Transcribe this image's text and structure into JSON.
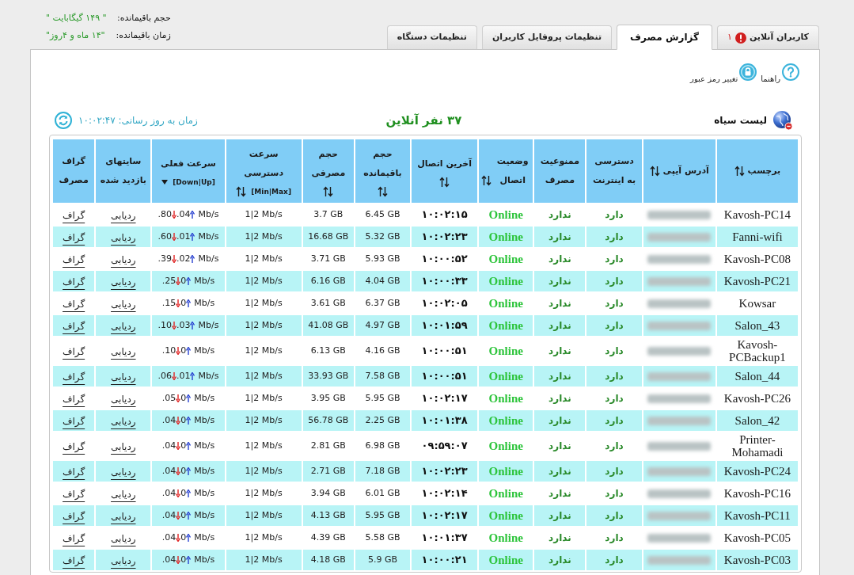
{
  "account": [
    {
      "label": "حجم باقیمانده:",
      "value": "\" ۱۴۹ گیگابایت \""
    },
    {
      "label": "زمان باقیمانده:",
      "value": "\"۱۴ ماه و ۴روز\""
    }
  ],
  "tabs": [
    {
      "label": "کاربران آنلاین",
      "selected": false,
      "alert": true,
      "count": "۱"
    },
    {
      "label": "گزارش مصرف",
      "selected": true,
      "alert": false
    },
    {
      "label": "تنظیمات پروفایل کاربران",
      "selected": false,
      "alert": false
    },
    {
      "label": "تنظیمات دستگاه",
      "selected": false,
      "alert": false
    }
  ],
  "toolbar": [
    {
      "kind": "help",
      "label": "راهنما"
    },
    {
      "kind": "password",
      "label": "تغییر رمز عبور"
    }
  ],
  "blacklist": {
    "label": "لیست سیاه"
  },
  "online_count": "۳۷ نفر آنلاین",
  "update_time": "زمان به روز رسانی: ۱۰:۰۲:۴۷",
  "table": {
    "columns": [
      {
        "label": "برچسب",
        "sortable": true,
        "sorted": false
      },
      {
        "label": "آدرس آیپی",
        "sortable": true,
        "sorted": false
      },
      {
        "label": "دسترسی به اینترنت",
        "sortable": false,
        "sorted": false
      },
      {
        "label": "ممنوعیت مصرف",
        "sortable": false,
        "sorted": false
      },
      {
        "label": "وضعیت اتصال",
        "sortable": true,
        "sorted": false
      },
      {
        "label": "آخرین اتصال",
        "sortable": true,
        "sorted": false
      },
      {
        "label": "حجم باقیمانده",
        "sortable": true,
        "sorted": false
      },
      {
        "label": "حجم مصرفی",
        "sortable": true,
        "sorted": false
      },
      {
        "label": "سرعت دسترسی",
        "sub": "[Min|Max]",
        "sortable": true,
        "sorted": false
      },
      {
        "label": "سرعت فعلی",
        "sub": "[Down|Up]",
        "sortable": false,
        "sorted": true
      },
      {
        "label": "سایتهای بازدید شده",
        "sortable": false,
        "sorted": false
      },
      {
        "label": "گراف مصرف",
        "sortable": false,
        "sorted": false
      }
    ],
    "rows": [
      {
        "name": "Kavosh-PC14",
        "internet": "دارد",
        "blocked": "ندارد",
        "status": "Online",
        "last_connection": "۱۰:۰۲:۱۵",
        "remaining": "6.45 GB",
        "used": "3.7 GB",
        "access_speed": "1|2 Mb/s",
        "down": ".80",
        "up": ".04",
        "unit": "Mb/s",
        "sites": "ردیابی",
        "graph": "گراف"
      },
      {
        "name": "Fanni-wifi",
        "internet": "دارد",
        "blocked": "ندارد",
        "status": "Online",
        "last_connection": "۱۰:۰۲:۲۳",
        "remaining": "5.32 GB",
        "used": "16.68 GB",
        "access_speed": "1|2 Mb/s",
        "down": ".60",
        "up": ".01",
        "unit": "Mb/s",
        "sites": "ردیابی",
        "graph": "گراف"
      },
      {
        "name": "Kavosh-PC08",
        "internet": "دارد",
        "blocked": "ندارد",
        "status": "Online",
        "last_connection": "۱۰:۰۰:۵۲",
        "remaining": "5.93 GB",
        "used": "3.71 GB",
        "access_speed": "1|2 Mb/s",
        "down": ".39",
        "up": ".02",
        "unit": "Mb/s",
        "sites": "ردیابی",
        "graph": "گراف"
      },
      {
        "name": "Kavosh-PC21",
        "internet": "دارد",
        "blocked": "ندارد",
        "status": "Online",
        "last_connection": "۱۰:۰۰:۳۳",
        "remaining": "4.04 GB",
        "used": "6.16 GB",
        "access_speed": "1|2 Mb/s",
        "down": ".25",
        "up": "0",
        "unit": "Mb/s",
        "sites": "ردیابی",
        "graph": "گراف"
      },
      {
        "name": "Kowsar",
        "internet": "دارد",
        "blocked": "ندارد",
        "status": "Online",
        "last_connection": "۱۰:۰۲:۰۵",
        "remaining": "6.37 GB",
        "used": "3.61 GB",
        "access_speed": "1|2 Mb/s",
        "down": ".15",
        "up": "0",
        "unit": "Mb/s",
        "sites": "ردیابی",
        "graph": "گراف"
      },
      {
        "name": "Salon_43",
        "internet": "دارد",
        "blocked": "ندارد",
        "status": "Online",
        "last_connection": "۱۰:۰۱:۵۹",
        "remaining": "4.97 GB",
        "used": "41.08 GB",
        "access_speed": "1|2 Mb/s",
        "down": ".10",
        "up": ".03",
        "unit": "Mb/s",
        "sites": "ردیابی",
        "graph": "گراف"
      },
      {
        "name": "Kavosh-PCBackup1",
        "internet": "دارد",
        "blocked": "ندارد",
        "status": "Online",
        "last_connection": "۱۰:۰۰:۵۱",
        "remaining": "4.16 GB",
        "used": "6.13 GB",
        "access_speed": "1|2 Mb/s",
        "down": ".10",
        "up": "0",
        "unit": "Mb/s",
        "sites": "ردیابی",
        "graph": "گراف"
      },
      {
        "name": "Salon_44",
        "internet": "دارد",
        "blocked": "ندارد",
        "status": "Online",
        "last_connection": "۱۰:۰۰:۵۱",
        "remaining": "7.58 GB",
        "used": "33.93 GB",
        "access_speed": "1|2 Mb/s",
        "down": ".06",
        "up": ".01",
        "unit": "Mb/s",
        "sites": "ردیابی",
        "graph": "گراف"
      },
      {
        "name": "Kavosh-PC26",
        "internet": "دارد",
        "blocked": "ندارد",
        "status": "Online",
        "last_connection": "۱۰:۰۲:۱۷",
        "remaining": "5.95 GB",
        "used": "3.95 GB",
        "access_speed": "1|2 Mb/s",
        "down": ".05",
        "up": "0",
        "unit": "Mb/s",
        "sites": "ردیابی",
        "graph": "گراف"
      },
      {
        "name": "Salon_42",
        "internet": "دارد",
        "blocked": "ندارد",
        "status": "Online",
        "last_connection": "۱۰:۰۱:۳۸",
        "remaining": "2.25 GB",
        "used": "56.78 GB",
        "access_speed": "1|2 Mb/s",
        "down": ".04",
        "up": "0",
        "unit": "Mb/s",
        "sites": "ردیابی",
        "graph": "گراف"
      },
      {
        "name": "Printer-Mohamadi",
        "internet": "دارد",
        "blocked": "ندارد",
        "status": "Online",
        "last_connection": "۰۹:۵۹:۰۷",
        "remaining": "6.98 GB",
        "used": "2.81 GB",
        "access_speed": "1|2 Mb/s",
        "down": ".04",
        "up": "0",
        "unit": "Mb/s",
        "sites": "ردیابی",
        "graph": "گراف"
      },
      {
        "name": "Kavosh-PC24",
        "internet": "دارد",
        "blocked": "ندارد",
        "status": "Online",
        "last_connection": "۱۰:۰۲:۲۳",
        "remaining": "7.18 GB",
        "used": "2.71 GB",
        "access_speed": "1|2 Mb/s",
        "down": ".04",
        "up": "0",
        "unit": "Mb/s",
        "sites": "ردیابی",
        "graph": "گراف"
      },
      {
        "name": "Kavosh-PC16",
        "internet": "دارد",
        "blocked": "ندارد",
        "status": "Online",
        "last_connection": "۱۰:۰۲:۱۴",
        "remaining": "6.01 GB",
        "used": "3.94 GB",
        "access_speed": "1|2 Mb/s",
        "down": ".04",
        "up": "0",
        "unit": "Mb/s",
        "sites": "ردیابی",
        "graph": "گراف"
      },
      {
        "name": "Kavosh-PC11",
        "internet": "دارد",
        "blocked": "ندارد",
        "status": "Online",
        "last_connection": "۱۰:۰۲:۱۷",
        "remaining": "5.95 GB",
        "used": "4.13 GB",
        "access_speed": "1|2 Mb/s",
        "down": ".04",
        "up": "0",
        "unit": "Mb/s",
        "sites": "ردیابی",
        "graph": "گراف"
      },
      {
        "name": "Kavosh-PC05",
        "internet": "دارد",
        "blocked": "ندارد",
        "status": "Online",
        "last_connection": "۱۰:۰۱:۳۷",
        "remaining": "5.58 GB",
        "used": "4.39 GB",
        "access_speed": "1|2 Mb/s",
        "down": ".04",
        "up": "0",
        "unit": "Mb/s",
        "sites": "ردیابی",
        "graph": "گراف"
      },
      {
        "name": "Kavosh-PC03",
        "internet": "دارد",
        "blocked": "ندارد",
        "status": "Online",
        "last_connection": "۱۰:۰۰:۲۱",
        "remaining": "5.9 GB",
        "used": "4.18 GB",
        "access_speed": "1|2 Mb/s",
        "down": ".04",
        "up": "0",
        "unit": "Mb/s",
        "sites": "ردیابی",
        "graph": "گراف"
      }
    ]
  }
}
